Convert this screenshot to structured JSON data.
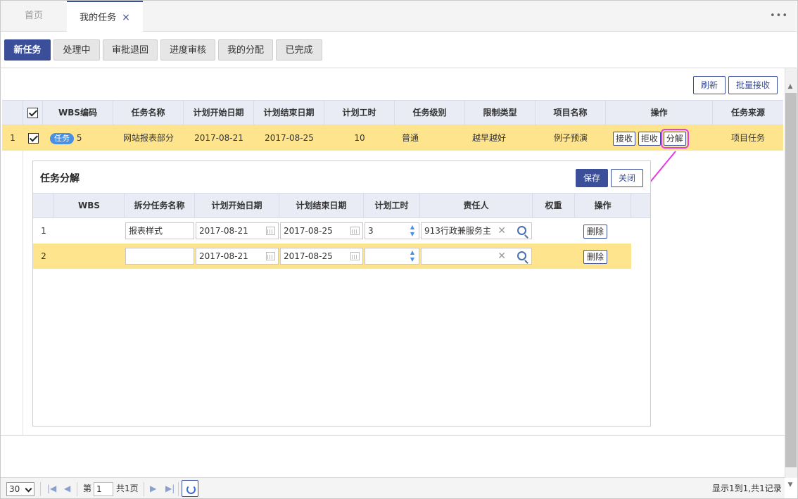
{
  "tabs": [
    {
      "label": "首页"
    },
    {
      "label": "我的任务",
      "close": "×"
    }
  ],
  "more": "•••",
  "status_buttons": [
    {
      "label": "新任务"
    },
    {
      "label": "处理中"
    },
    {
      "label": "审批退回"
    },
    {
      "label": "进度审核"
    },
    {
      "label": "我的分配"
    },
    {
      "label": "已完成"
    }
  ],
  "toolbar": {
    "refresh": "刷新",
    "batch_accept": "批量接收"
  },
  "grid": {
    "headers": [
      "WBS编码",
      "任务名称",
      "计划开始日期",
      "计划结束日期",
      "计划工时",
      "任务级别",
      "限制类型",
      "项目名称",
      "操作",
      "任务来源"
    ],
    "row": {
      "index": "1",
      "tag": "任务",
      "wbs": "5",
      "name": "网站报表部分",
      "start": "2017-08-21",
      "end": "2017-08-25",
      "hours": "10",
      "level": "普通",
      "limit": "越早越好",
      "project": "例子预演",
      "ops": [
        "接收",
        "拒收",
        "分解"
      ],
      "source": "项目任务"
    }
  },
  "panel": {
    "title": "任务分解",
    "save": "保存",
    "close": "关闭",
    "headers": [
      "WBS",
      "拆分任务名称",
      "计划开始日期",
      "计划结束日期",
      "计划工时",
      "责任人",
      "权重",
      "操作"
    ],
    "rows": [
      {
        "index": "1",
        "name": "报表样式",
        "start": "2017-08-21",
        "end": "2017-08-25",
        "hours": "3",
        "owner": "913行政兼服务主",
        "delete": "删除"
      },
      {
        "index": "2",
        "name": "",
        "start": "2017-08-21",
        "end": "2017-08-25",
        "hours": "",
        "owner": "",
        "delete": "删除"
      }
    ]
  },
  "footer": {
    "page_size": "30",
    "page_prefix": "第",
    "page": "1",
    "page_total": "共1页",
    "summary": "显示1到1,共1记录"
  },
  "colors": {
    "primary": "#3a4e9a",
    "row_highlight": "#ffe48e",
    "annotation": "#e33be3"
  }
}
